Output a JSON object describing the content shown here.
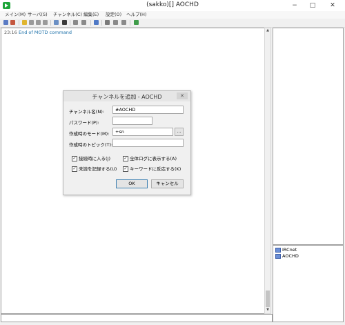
{
  "window": {
    "title": "(sakko)[] AOCHD",
    "minimize": "−",
    "maximize": "□",
    "close": "✕"
  },
  "menu": [
    "メイン(M)",
    "サーバ(S)",
    "チャンネル(C)",
    "編集(E)",
    "設定(O)",
    "ヘルプ(H)"
  ],
  "log": {
    "time": "23:16",
    "message": "End of MOTD command"
  },
  "channels": [
    "IRCnet",
    "AOCHD"
  ],
  "dialog": {
    "title": "チャンネルを追加 - AOCHD",
    "close": "✕",
    "labels": {
      "channel_name": "チャンネル名(N):",
      "password": "パスワード(P):",
      "mode": "作成時のモード(M):",
      "topic": "作成時のトピック(T):"
    },
    "values": {
      "channel_name": "#AOCHD",
      "password": "",
      "mode": "+sn",
      "topic": ""
    },
    "browse_button": "...",
    "checkboxes": [
      {
        "label": "接続時に入る(J)",
        "checked": true
      },
      {
        "label": "全体ログに表示する(A)",
        "checked": true
      },
      {
        "label": "未読を記録する(U)",
        "checked": true
      },
      {
        "label": "キーワードに反応する(K)",
        "checked": true
      }
    ],
    "ok": "OK",
    "cancel": "キャンセル"
  },
  "colors": {
    "accent": "#1ea53a",
    "log_text": "#1a6fa8"
  }
}
